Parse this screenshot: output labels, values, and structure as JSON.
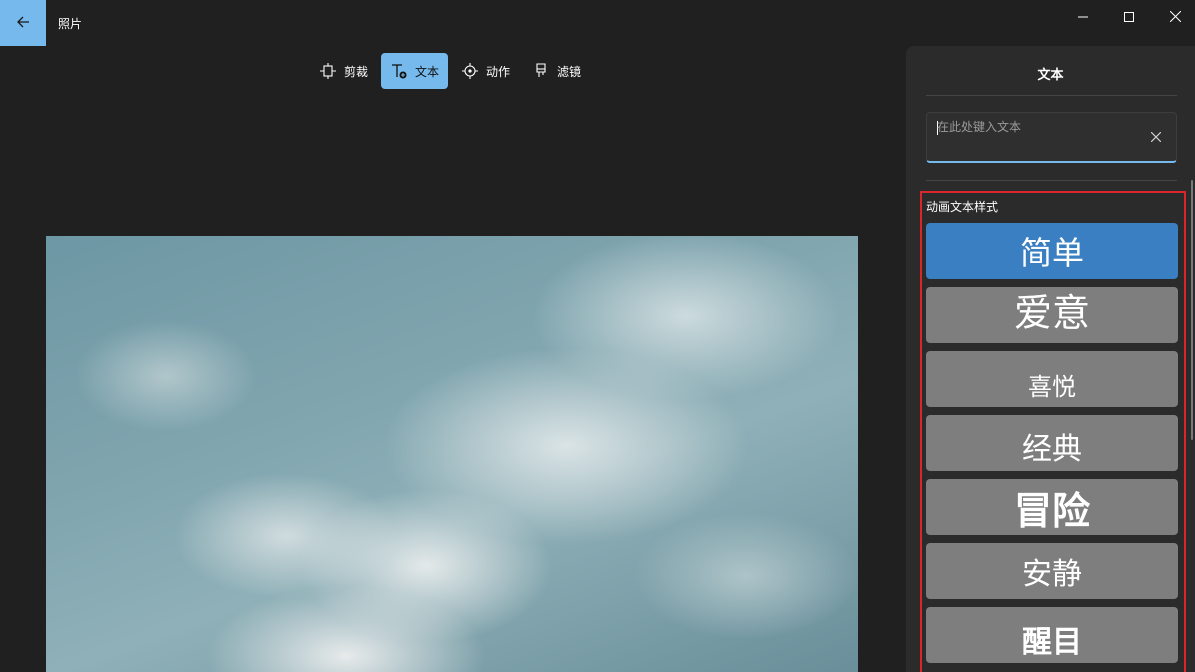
{
  "app": {
    "title": "照片"
  },
  "toolbar": {
    "items": [
      {
        "label": "剪裁",
        "icon": "crop-icon"
      },
      {
        "label": "文本",
        "icon": "text-icon",
        "active": true
      },
      {
        "label": "动作",
        "icon": "motion-icon"
      },
      {
        "label": "滤镜",
        "icon": "filter-icon"
      }
    ]
  },
  "panel": {
    "title": "文本",
    "input": {
      "value": "",
      "placeholder": "在此处键入文本"
    },
    "styles_heading": "动画文本样式",
    "styles": [
      {
        "label": "简单",
        "selected": true
      },
      {
        "label": "爱意"
      },
      {
        "label": "喜悦"
      },
      {
        "label": "经典"
      },
      {
        "label": "冒险"
      },
      {
        "label": "安静"
      },
      {
        "label": "醒目"
      }
    ]
  },
  "colors": {
    "accent": "#76b9ed",
    "selected_style": "#3a7fc2",
    "style_button": "#7e7e7e",
    "highlight_border": "#d9262b",
    "background": "#202020",
    "panel": "#2b2b2b"
  }
}
